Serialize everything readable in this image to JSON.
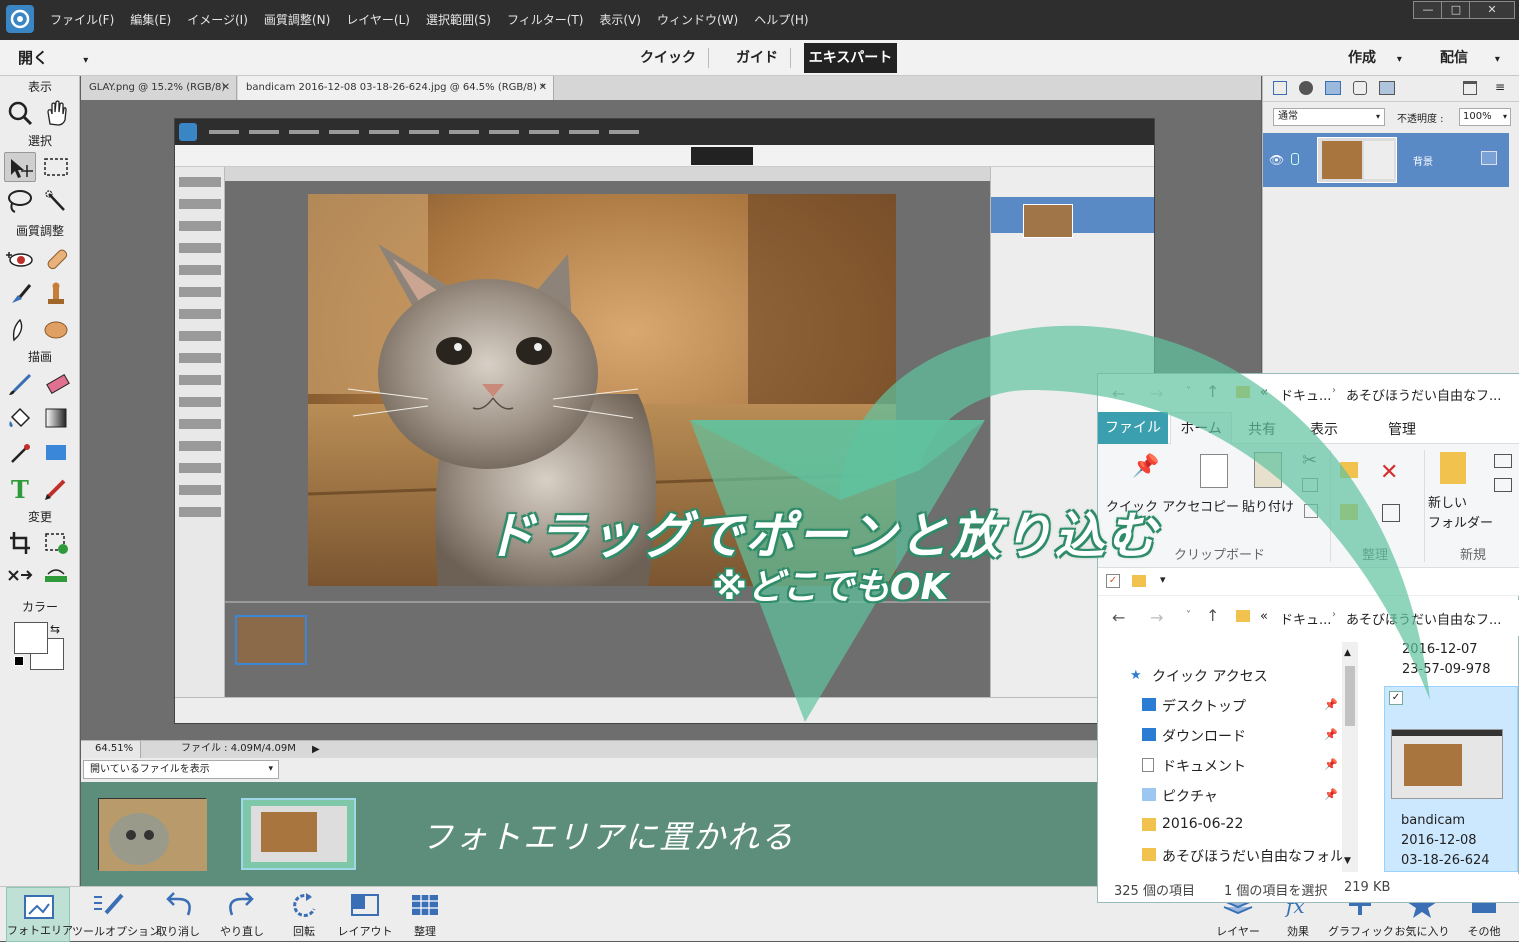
{
  "menubar": {
    "items": [
      "ファイル(F)",
      "編集(E)",
      "イメージ(I)",
      "画質調整(N)",
      "レイヤー(L)",
      "選択範囲(S)",
      "フィルター(T)",
      "表示(V)",
      "ウィンドウ(W)",
      "ヘルプ(H)"
    ]
  },
  "modebar": {
    "open_label": "開く",
    "modes": [
      "クイック",
      "ガイド",
      "エキスパート"
    ],
    "create_label": "作成",
    "share_label": "配信"
  },
  "toolbox": {
    "groups": [
      "表示",
      "選択",
      "画質調整",
      "描画",
      "変更",
      "カラー"
    ]
  },
  "tabs": [
    {
      "label": "GLAY.png @ 15.2% (RGB/8)"
    },
    {
      "label": "bandicam 2016-12-08 03-18-26-624.jpg @ 64.5% (RGB/8) *"
    }
  ],
  "status": {
    "zoom": "64.51%",
    "file": "ファイル : 4.09M/4.09M"
  },
  "bin": {
    "dropdown": "開いているファイルを表示"
  },
  "layers": {
    "blend_mode": "通常",
    "opacity_label": "不透明度 :",
    "opacity_value": "100%",
    "layer_name": "背景"
  },
  "taskbar": {
    "left": [
      "フォトエリア",
      "ツールオプション",
      "取り消し",
      "やり直し",
      "回転",
      "レイアウト",
      "整理"
    ],
    "right": [
      "レイヤー",
      "効果",
      "グラフィック",
      "お気に入り",
      "その他"
    ]
  },
  "explorer": {
    "path_crumbs": [
      "«",
      "ドキュ...",
      "あそびほうだい自由なフ..."
    ],
    "ribbon_tabs": [
      "ファイル",
      "ホーム",
      "共有",
      "表示",
      "管理"
    ],
    "ribbon_buttons": [
      "クイック アクセ",
      "コピー",
      "貼り付け",
      "新しい\nフォルダー"
    ],
    "ribbon_groups": [
      "クリップボード",
      "整理",
      "新規"
    ],
    "nav_items": [
      "クイック アクセス",
      "デスクトップ",
      "ダウンロード",
      "ドキュメント",
      "ピクチャ",
      "2016-06-22",
      "あそびほうだい自由なフォルダ"
    ],
    "file_top_name": "2016-12-07\n23-57-09-978",
    "file_selected_name": [
      "bandicam",
      "2016-12-08",
      "03-18-26-624"
    ],
    "status_count": "325 個の項目",
    "status_selected": "1 個の項目を選択",
    "status_size": "219 KB"
  },
  "overlay": {
    "main_text": "ドラッグでポーンと放り込む",
    "sub_text": "※どこでもOK",
    "bin_text": "フォトエリアに置かれる"
  },
  "colors": {
    "arrow_green": "#5fc3a0",
    "bin_green": "#5d8d7b",
    "layer_selected": "#5a8ac6",
    "explorer_accent": "#3b9fb0"
  }
}
